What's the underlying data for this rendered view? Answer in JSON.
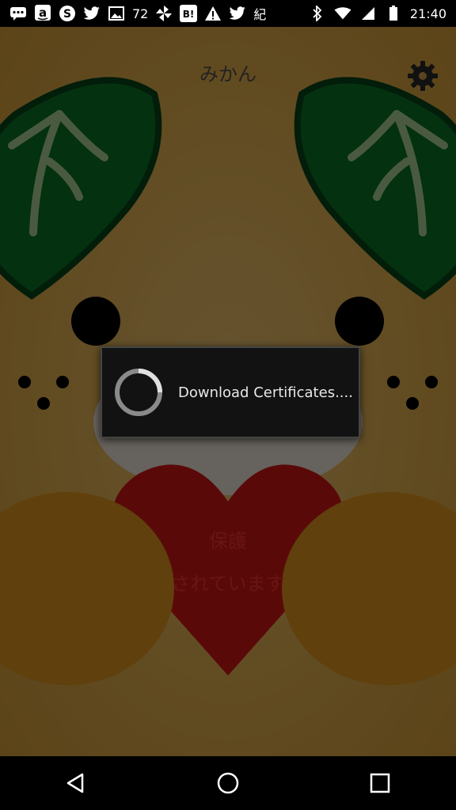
{
  "status_bar": {
    "notification_icons": [
      "chat-bubble-icon",
      "amazon-icon",
      "skype-icon",
      "twitter-icon",
      "image-icon"
    ],
    "notification_count": "72",
    "more_icons": [
      "pinwheel-icon",
      "hatena-bookmark-icon",
      "warning-icon",
      "twitter-icon"
    ],
    "kanji": "紀",
    "time": "21:40",
    "colors": {
      "background": "#000000",
      "text": "#ffffff"
    }
  },
  "app": {
    "title": "みかん",
    "settings_icon": "gear-icon",
    "heart_text_line1": "保護",
    "heart_text_line2": "されています",
    "colors": {
      "face": "#f4bd55",
      "leaf": "#0a7a2a",
      "heart": "#e01818",
      "cheek": "#f0a020"
    }
  },
  "dialog": {
    "message": "Download Certificates....",
    "icon": "spinner-icon"
  },
  "nav_bar": {
    "back": "back-icon",
    "home": "home-icon",
    "recents": "recents-icon"
  }
}
